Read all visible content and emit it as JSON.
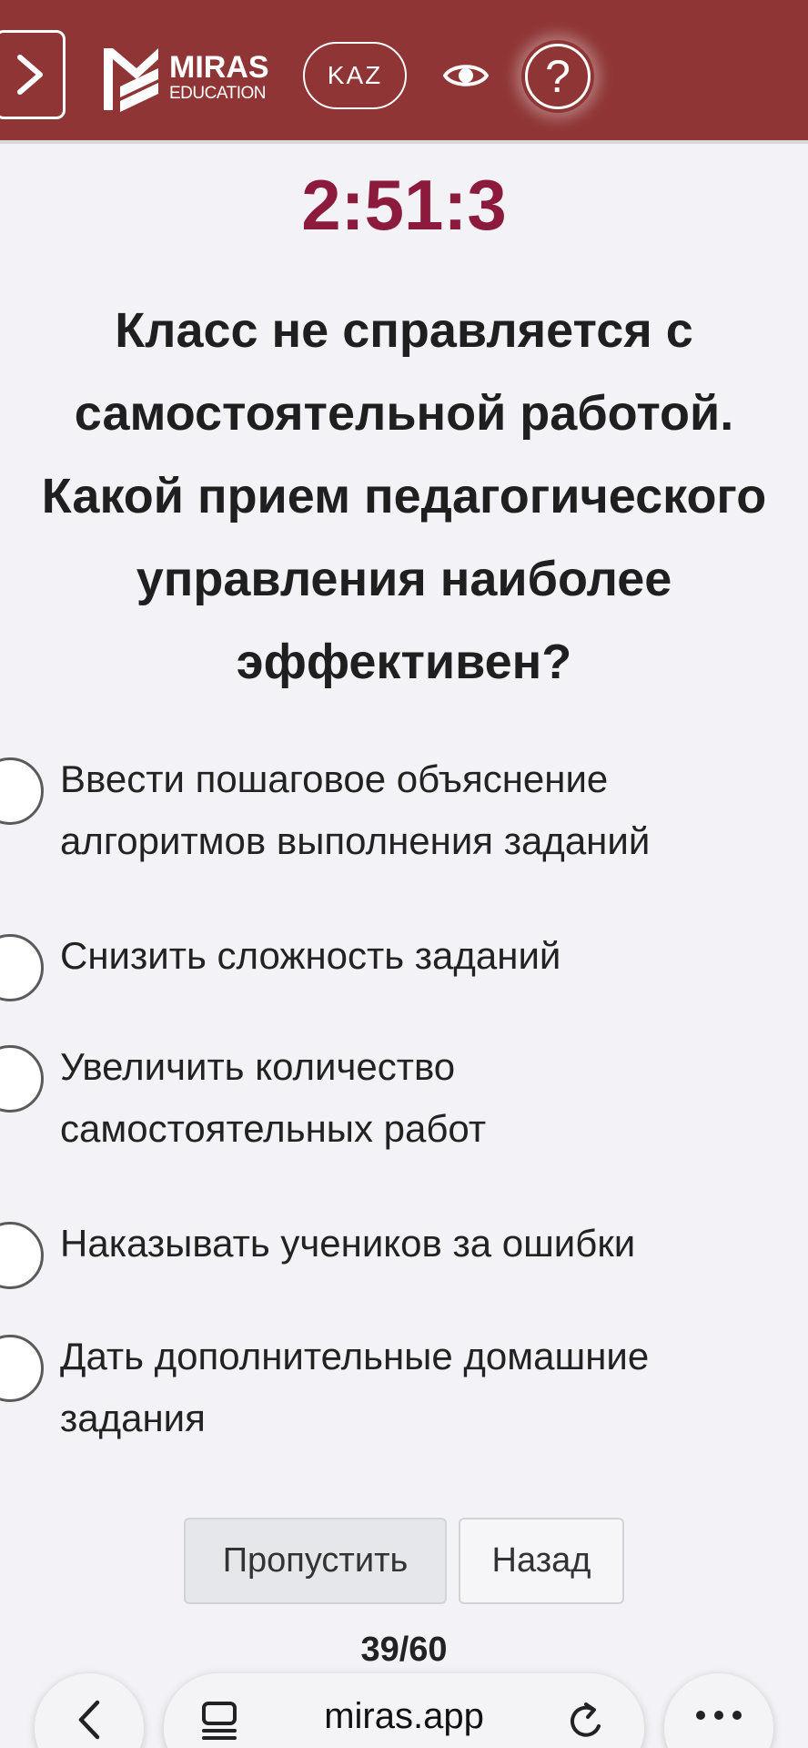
{
  "header": {
    "logo_brand": "MIRAS",
    "logo_sub": "EDUCATION",
    "language": "KAZ",
    "help_symbol": "?",
    "icons": {
      "menu": "chevron-right-icon",
      "logo": "miras-logo-icon",
      "accessibility": "eye-icon",
      "help": "question-icon"
    },
    "background_color": "#8f3535"
  },
  "timer": {
    "value": "2:51:3",
    "color": "#8c1a3c"
  },
  "question": {
    "text": "Класс не справляется с\nсамостоятельной работой.\nКакой прием педагогического\nуправления наиболее\nэффективен?"
  },
  "options": [
    {
      "text": "Ввести пошаговое объяснение\nалгоритмов выполнения заданий",
      "selected": false
    },
    {
      "text": "Снизить сложность заданий",
      "selected": false
    },
    {
      "text": "Увеличить количество\nсамостоятельных работ",
      "selected": false
    },
    {
      "text": "Наказывать учеников за ошибки",
      "selected": false
    },
    {
      "text": "Дать дополнительные домашние\nзадания",
      "selected": false
    }
  ],
  "actions": {
    "skip_label": "Пропустить",
    "back_label": "Назад"
  },
  "progress": {
    "text": "39/60",
    "current": 39,
    "total": 60
  },
  "browser": {
    "url": "miras.app",
    "icons": {
      "back": "chevron-left-icon",
      "tabs": "tabs-icon",
      "reload": "reload-icon",
      "more": "more-icon"
    }
  }
}
